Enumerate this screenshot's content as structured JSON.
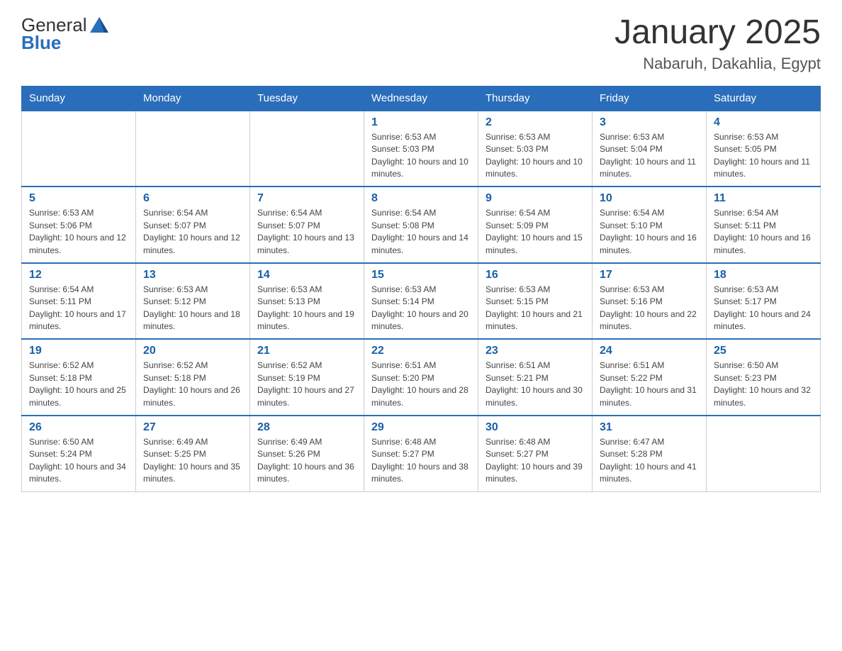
{
  "header": {
    "logo_general": "General",
    "logo_blue": "Blue",
    "month": "January 2025",
    "location": "Nabaruh, Dakahlia, Egypt"
  },
  "weekdays": [
    "Sunday",
    "Monday",
    "Tuesday",
    "Wednesday",
    "Thursday",
    "Friday",
    "Saturday"
  ],
  "weeks": [
    [
      {
        "day": "",
        "sunrise": "",
        "sunset": "",
        "daylight": ""
      },
      {
        "day": "",
        "sunrise": "",
        "sunset": "",
        "daylight": ""
      },
      {
        "day": "",
        "sunrise": "",
        "sunset": "",
        "daylight": ""
      },
      {
        "day": "1",
        "sunrise": "Sunrise: 6:53 AM",
        "sunset": "Sunset: 5:03 PM",
        "daylight": "Daylight: 10 hours and 10 minutes."
      },
      {
        "day": "2",
        "sunrise": "Sunrise: 6:53 AM",
        "sunset": "Sunset: 5:03 PM",
        "daylight": "Daylight: 10 hours and 10 minutes."
      },
      {
        "day": "3",
        "sunrise": "Sunrise: 6:53 AM",
        "sunset": "Sunset: 5:04 PM",
        "daylight": "Daylight: 10 hours and 11 minutes."
      },
      {
        "day": "4",
        "sunrise": "Sunrise: 6:53 AM",
        "sunset": "Sunset: 5:05 PM",
        "daylight": "Daylight: 10 hours and 11 minutes."
      }
    ],
    [
      {
        "day": "5",
        "sunrise": "Sunrise: 6:53 AM",
        "sunset": "Sunset: 5:06 PM",
        "daylight": "Daylight: 10 hours and 12 minutes."
      },
      {
        "day": "6",
        "sunrise": "Sunrise: 6:54 AM",
        "sunset": "Sunset: 5:07 PM",
        "daylight": "Daylight: 10 hours and 12 minutes."
      },
      {
        "day": "7",
        "sunrise": "Sunrise: 6:54 AM",
        "sunset": "Sunset: 5:07 PM",
        "daylight": "Daylight: 10 hours and 13 minutes."
      },
      {
        "day": "8",
        "sunrise": "Sunrise: 6:54 AM",
        "sunset": "Sunset: 5:08 PM",
        "daylight": "Daylight: 10 hours and 14 minutes."
      },
      {
        "day": "9",
        "sunrise": "Sunrise: 6:54 AM",
        "sunset": "Sunset: 5:09 PM",
        "daylight": "Daylight: 10 hours and 15 minutes."
      },
      {
        "day": "10",
        "sunrise": "Sunrise: 6:54 AM",
        "sunset": "Sunset: 5:10 PM",
        "daylight": "Daylight: 10 hours and 16 minutes."
      },
      {
        "day": "11",
        "sunrise": "Sunrise: 6:54 AM",
        "sunset": "Sunset: 5:11 PM",
        "daylight": "Daylight: 10 hours and 16 minutes."
      }
    ],
    [
      {
        "day": "12",
        "sunrise": "Sunrise: 6:54 AM",
        "sunset": "Sunset: 5:11 PM",
        "daylight": "Daylight: 10 hours and 17 minutes."
      },
      {
        "day": "13",
        "sunrise": "Sunrise: 6:53 AM",
        "sunset": "Sunset: 5:12 PM",
        "daylight": "Daylight: 10 hours and 18 minutes."
      },
      {
        "day": "14",
        "sunrise": "Sunrise: 6:53 AM",
        "sunset": "Sunset: 5:13 PM",
        "daylight": "Daylight: 10 hours and 19 minutes."
      },
      {
        "day": "15",
        "sunrise": "Sunrise: 6:53 AM",
        "sunset": "Sunset: 5:14 PM",
        "daylight": "Daylight: 10 hours and 20 minutes."
      },
      {
        "day": "16",
        "sunrise": "Sunrise: 6:53 AM",
        "sunset": "Sunset: 5:15 PM",
        "daylight": "Daylight: 10 hours and 21 minutes."
      },
      {
        "day": "17",
        "sunrise": "Sunrise: 6:53 AM",
        "sunset": "Sunset: 5:16 PM",
        "daylight": "Daylight: 10 hours and 22 minutes."
      },
      {
        "day": "18",
        "sunrise": "Sunrise: 6:53 AM",
        "sunset": "Sunset: 5:17 PM",
        "daylight": "Daylight: 10 hours and 24 minutes."
      }
    ],
    [
      {
        "day": "19",
        "sunrise": "Sunrise: 6:52 AM",
        "sunset": "Sunset: 5:18 PM",
        "daylight": "Daylight: 10 hours and 25 minutes."
      },
      {
        "day": "20",
        "sunrise": "Sunrise: 6:52 AM",
        "sunset": "Sunset: 5:18 PM",
        "daylight": "Daylight: 10 hours and 26 minutes."
      },
      {
        "day": "21",
        "sunrise": "Sunrise: 6:52 AM",
        "sunset": "Sunset: 5:19 PM",
        "daylight": "Daylight: 10 hours and 27 minutes."
      },
      {
        "day": "22",
        "sunrise": "Sunrise: 6:51 AM",
        "sunset": "Sunset: 5:20 PM",
        "daylight": "Daylight: 10 hours and 28 minutes."
      },
      {
        "day": "23",
        "sunrise": "Sunrise: 6:51 AM",
        "sunset": "Sunset: 5:21 PM",
        "daylight": "Daylight: 10 hours and 30 minutes."
      },
      {
        "day": "24",
        "sunrise": "Sunrise: 6:51 AM",
        "sunset": "Sunset: 5:22 PM",
        "daylight": "Daylight: 10 hours and 31 minutes."
      },
      {
        "day": "25",
        "sunrise": "Sunrise: 6:50 AM",
        "sunset": "Sunset: 5:23 PM",
        "daylight": "Daylight: 10 hours and 32 minutes."
      }
    ],
    [
      {
        "day": "26",
        "sunrise": "Sunrise: 6:50 AM",
        "sunset": "Sunset: 5:24 PM",
        "daylight": "Daylight: 10 hours and 34 minutes."
      },
      {
        "day": "27",
        "sunrise": "Sunrise: 6:49 AM",
        "sunset": "Sunset: 5:25 PM",
        "daylight": "Daylight: 10 hours and 35 minutes."
      },
      {
        "day": "28",
        "sunrise": "Sunrise: 6:49 AM",
        "sunset": "Sunset: 5:26 PM",
        "daylight": "Daylight: 10 hours and 36 minutes."
      },
      {
        "day": "29",
        "sunrise": "Sunrise: 6:48 AM",
        "sunset": "Sunset: 5:27 PM",
        "daylight": "Daylight: 10 hours and 38 minutes."
      },
      {
        "day": "30",
        "sunrise": "Sunrise: 6:48 AM",
        "sunset": "Sunset: 5:27 PM",
        "daylight": "Daylight: 10 hours and 39 minutes."
      },
      {
        "day": "31",
        "sunrise": "Sunrise: 6:47 AM",
        "sunset": "Sunset: 5:28 PM",
        "daylight": "Daylight: 10 hours and 41 minutes."
      },
      {
        "day": "",
        "sunrise": "",
        "sunset": "",
        "daylight": ""
      }
    ]
  ],
  "colors": {
    "header_bg": "#2a6ebb",
    "day_number_color": "#1a5fa8",
    "border_color": "#999"
  }
}
